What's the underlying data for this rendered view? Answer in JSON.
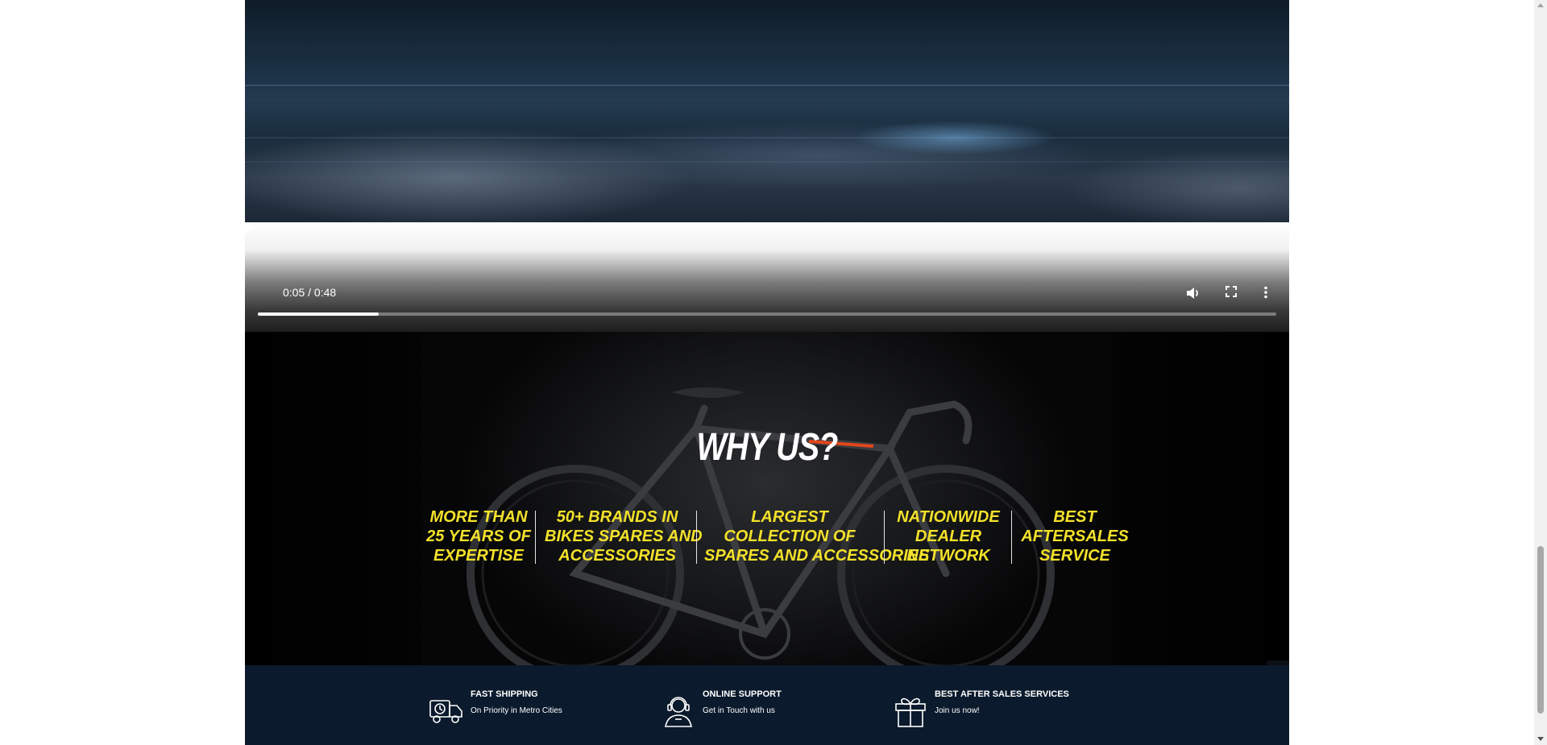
{
  "video": {
    "time": "0:05 / 0:48",
    "progress_fraction": 0.119
  },
  "why_us": {
    "title": "WHY US?",
    "features": [
      {
        "lines": [
          "MORE THAN",
          "25 YEARS OF",
          "EXPERTISE"
        ]
      },
      {
        "lines": [
          "50+ BRANDS IN",
          "BIKES SPARES AND",
          "ACCESSORIES"
        ]
      },
      {
        "lines": [
          "LARGEST",
          "COLLECTION OF",
          "SPARES AND ACCESSORIES"
        ]
      },
      {
        "lines": [
          "NATIONWIDE",
          "DEALER",
          "NETWORK"
        ]
      },
      {
        "lines": [
          "BEST",
          "AFTERSALES",
          "SERVICE"
        ]
      }
    ],
    "accent_color": "#f3e12a"
  },
  "services": [
    {
      "title": "FAST SHIPPING",
      "subtitle": "On Priority in Metro Cities",
      "icon": "delivery-truck-icon"
    },
    {
      "title": "ONLINE SUPPORT",
      "subtitle": "Get in Touch with us",
      "icon": "support-agent-icon"
    },
    {
      "title": "BEST AFTER SALES SERVICES",
      "subtitle": "Join us now!",
      "icon": "gift-icon"
    }
  ],
  "colors": {
    "services_bg": "#0b1a2c"
  }
}
